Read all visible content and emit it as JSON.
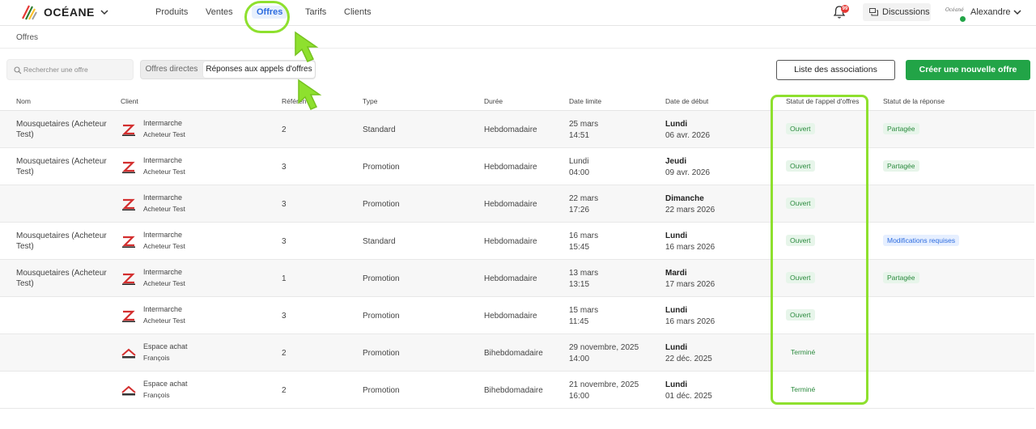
{
  "header": {
    "brand": "OCÉANE",
    "nav": [
      "Produits",
      "Ventes",
      "Offres",
      "Tarifs",
      "Clients"
    ],
    "notifications_count": "99",
    "discussions_label": "Discussions",
    "user_logo_text": "Océané",
    "user_name": "Alexandre"
  },
  "breadcrumb": "Offres",
  "toolbar": {
    "search_placeholder": "Rechercher une offre",
    "segment_options": [
      "Offres directes",
      "Réponses aux appels d'offres"
    ],
    "associations_label": "Liste des associations",
    "create_label": "Créer une nouvelle offre"
  },
  "table": {
    "columns": [
      "Nom",
      "Client",
      "Référence",
      "Type",
      "Durée",
      "Date limite",
      "Date de début",
      "Statut de l'appel d'offres",
      "Statut de la réponse"
    ],
    "rows": [
      {
        "name": "Mousquetaires (Acheteur Test)",
        "client": "Intermarche",
        "client_sub": "Acheteur Test",
        "ref": "2",
        "type": "Standard",
        "duree": "Hebdomadaire",
        "dl1": "25 mars",
        "dl2": "14:51",
        "dd1": "Lundi",
        "dd2": "06 avr. 2026",
        "statut_ao": "Ouvert",
        "statut_rep": "Partagée"
      },
      {
        "name": "Mousquetaires (Acheteur Test)",
        "client": "Intermarche",
        "client_sub": "Acheteur Test",
        "ref": "3",
        "type": "Promotion",
        "duree": "Hebdomadaire",
        "dl1": "Lundi",
        "dl2": "04:00",
        "dd1": "Jeudi",
        "dd2": "09 avr. 2026",
        "statut_ao": "Ouvert",
        "statut_rep": "Partagée"
      },
      {
        "name": "",
        "client": "Intermarche",
        "client_sub": "Acheteur Test",
        "ref": "3",
        "type": "Promotion",
        "duree": "Hebdomadaire",
        "dl1": "22 mars",
        "dl2": "17:26",
        "dd1": "Dimanche",
        "dd2": "22 mars 2026",
        "statut_ao": "Ouvert",
        "statut_rep": ""
      },
      {
        "name": "Mousquetaires (Acheteur Test)",
        "client": "Intermarche",
        "client_sub": "Acheteur Test",
        "ref": "3",
        "type": "Standard",
        "duree": "Hebdomadaire",
        "dl1": "16 mars",
        "dl2": "15:45",
        "dd1": "Lundi",
        "dd2": "16 mars 2026",
        "statut_ao": "Ouvert",
        "statut_rep": "Modifications requises"
      },
      {
        "name": "Mousquetaires (Acheteur Test)",
        "client": "Intermarche",
        "client_sub": "Acheteur Test",
        "ref": "1",
        "type": "Promotion",
        "duree": "Hebdomadaire",
        "dl1": "13 mars",
        "dl2": "13:15",
        "dd1": "Mardi",
        "dd2": "17 mars 2026",
        "statut_ao": "Ouvert",
        "statut_rep": "Partagée"
      },
      {
        "name": "",
        "client": "Intermarche",
        "client_sub": "Acheteur Test",
        "ref": "3",
        "type": "Promotion",
        "duree": "Hebdomadaire",
        "dl1": "15 mars",
        "dl2": "11:45",
        "dd1": "Lundi",
        "dd2": "16 mars 2026",
        "statut_ao": "Ouvert",
        "statut_rep": ""
      },
      {
        "name": "",
        "client": "Espace achat",
        "client_sub": "François",
        "ref": "2",
        "type": "Promotion",
        "duree": "Bihebdomadaire",
        "dl1": "29 novembre, 2025",
        "dl2": "14:00",
        "dd1": "Lundi",
        "dd2": "22 déc. 2025",
        "statut_ao": "Terminé",
        "statut_rep": ""
      },
      {
        "name": "",
        "client": "Espace achat",
        "client_sub": "François",
        "ref": "2",
        "type": "Promotion",
        "duree": "Bihebdomadaire",
        "dl1": "21 novembre, 2025",
        "dl2": "16:00",
        "dd1": "Lundi",
        "dd2": "01 déc. 2025",
        "statut_ao": "Terminé",
        "statut_rep": ""
      }
    ]
  },
  "colors": {
    "accent_green": "#22a447",
    "nav_active": "#2d6cdf",
    "annotation_highlight": "#8ee02e",
    "badge_green_bg": "#e7f5ea",
    "badge_blue_bg": "#e6efff"
  },
  "icons": [
    "logo-icon",
    "chevron-down-icon",
    "bell-icon",
    "chat-icon",
    "search-icon",
    "client-logo-icon",
    "arrow-pointer-icon"
  ]
}
